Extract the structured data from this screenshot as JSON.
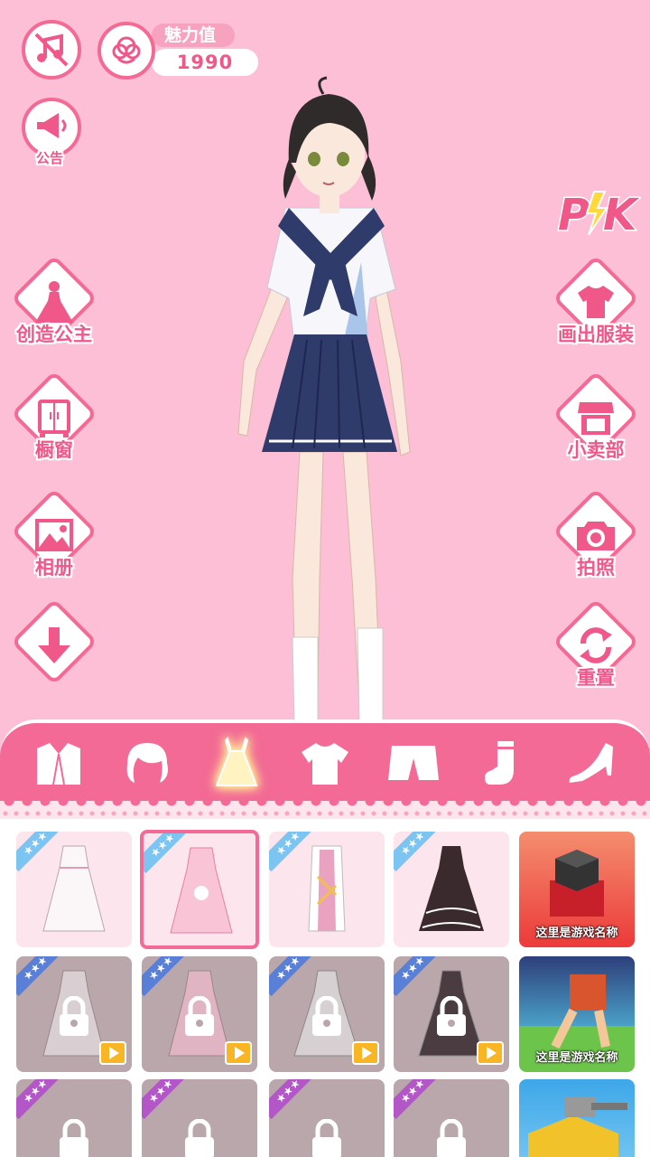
{
  "top": {
    "music_icon": "music-off-icon",
    "charm_label": "魅力值",
    "charm_value": "1990",
    "notice_label": "公告"
  },
  "pk_label": "PK",
  "left_buttons": [
    {
      "label": "创造公主",
      "icon": "princess-icon"
    },
    {
      "label": "橱窗",
      "icon": "wardrobe-icon"
    },
    {
      "label": "相册",
      "icon": "photo-album-icon"
    },
    {
      "label": "",
      "icon": "download-arrow-icon"
    }
  ],
  "right_buttons": [
    {
      "label": "画出服装",
      "icon": "shirt-icon"
    },
    {
      "label": "小卖部",
      "icon": "shop-icon"
    },
    {
      "label": "拍照",
      "icon": "camera-icon"
    },
    {
      "label": "重置",
      "icon": "reset-icon"
    }
  ],
  "categories": [
    {
      "icon": "coat-icon",
      "active": false
    },
    {
      "icon": "hair-icon",
      "active": false
    },
    {
      "icon": "dress-icon",
      "active": true
    },
    {
      "icon": "tshirt-icon",
      "active": false
    },
    {
      "icon": "shorts-icon",
      "active": false
    },
    {
      "icon": "sock-icon",
      "active": false
    },
    {
      "icon": "heel-shoe-icon",
      "active": false
    }
  ],
  "ads": [
    {
      "title": "这里是游戏名称"
    },
    {
      "title": "这里是游戏名称"
    },
    {
      "title": ""
    }
  ],
  "colors": {
    "background": "#fcbfd6",
    "accent": "#f26a95",
    "locked": "#b9a7ab"
  }
}
